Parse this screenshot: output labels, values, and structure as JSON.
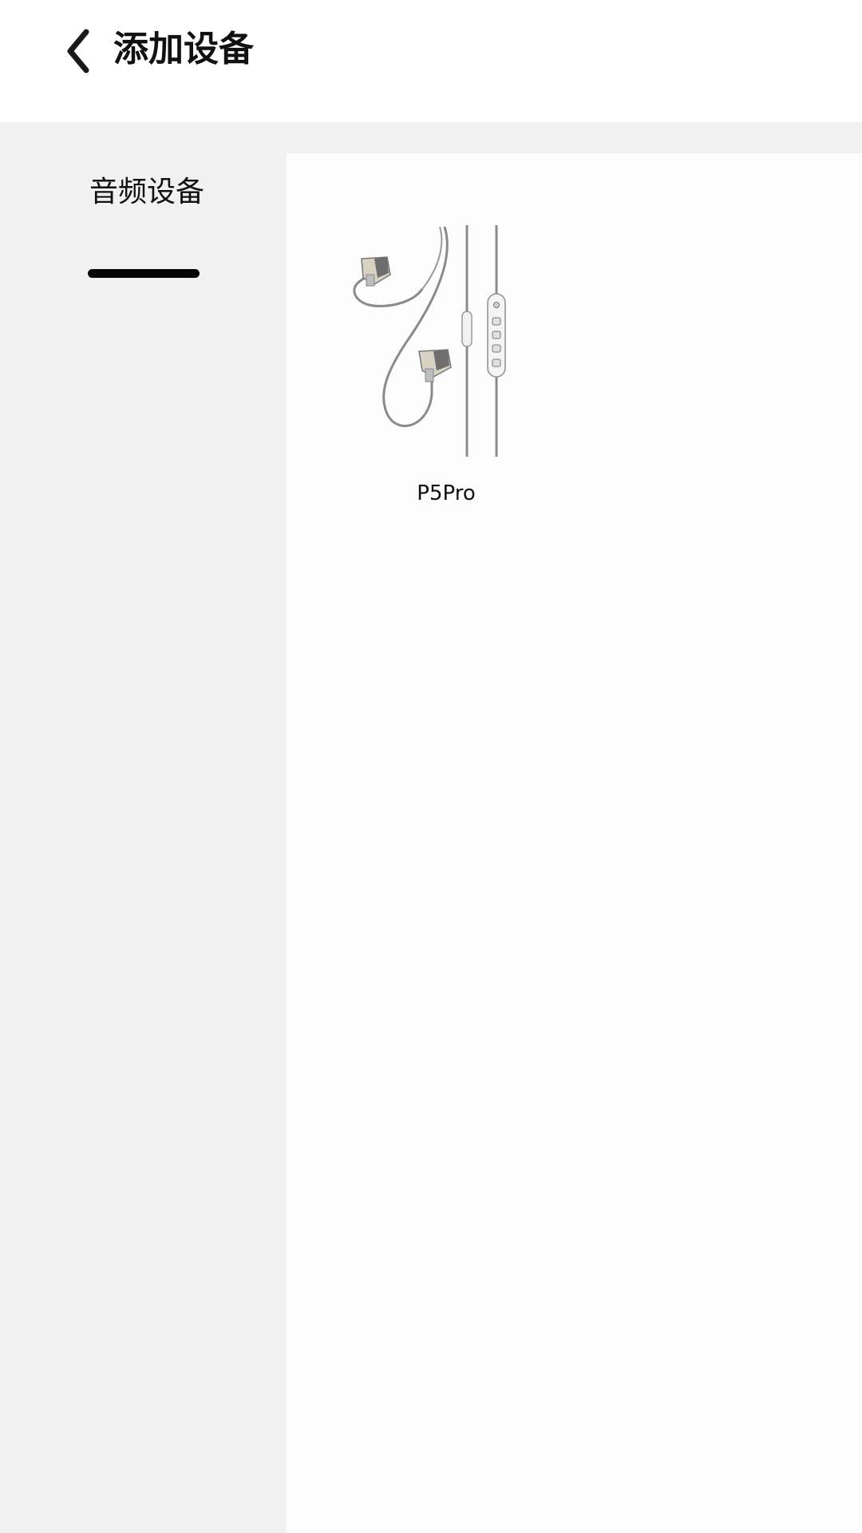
{
  "header": {
    "back_icon": "chevron-left-icon",
    "title": "添加设备"
  },
  "sidebar": {
    "categories": [
      {
        "label": "音频设备",
        "active": true
      }
    ]
  },
  "devices": [
    {
      "name": "P5Pro",
      "image": "earphones-image"
    }
  ],
  "colors": {
    "header_bg": "#ffffff",
    "sidebar_bg": "#f1f1f1",
    "content_bg": "#fdfdfd",
    "active_indicator": "#050505",
    "text": "#111111"
  }
}
